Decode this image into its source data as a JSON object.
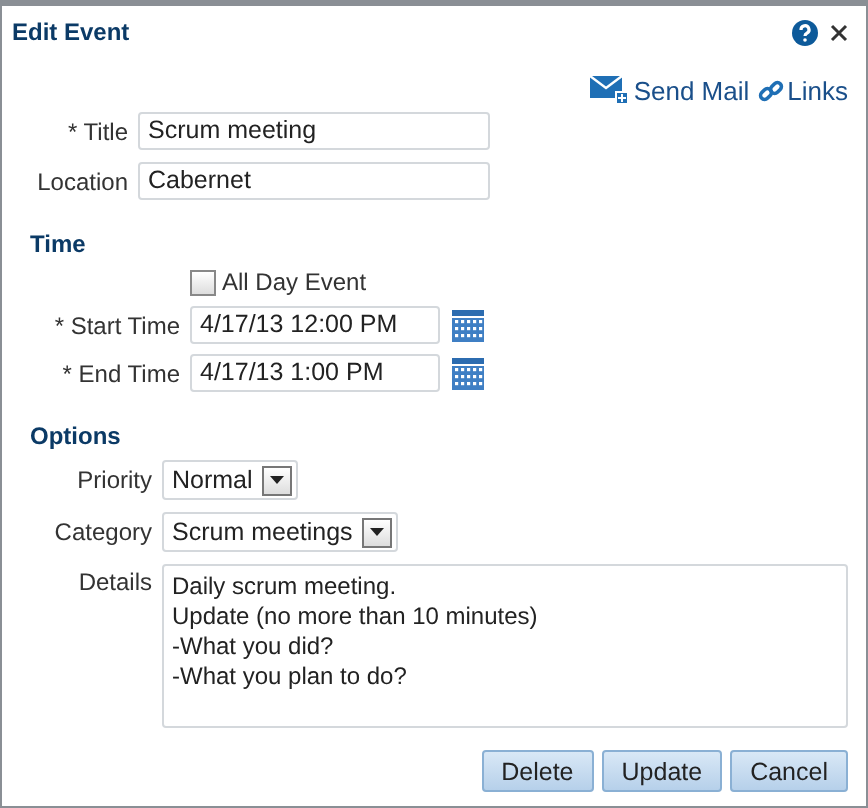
{
  "window": {
    "title": "Edit Event"
  },
  "actions": [
    {
      "kind": "mail",
      "label": "Send Mail"
    },
    {
      "kind": "link",
      "label": "Links"
    }
  ],
  "general": [
    {
      "label": "* Title",
      "value": "Scrum meeting"
    },
    {
      "label": "Location",
      "value": "Cabernet"
    }
  ],
  "time": {
    "heading": "Time",
    "all_day": {
      "label": "All Day Event",
      "checked": false
    },
    "fields": [
      {
        "label": "* Start Time",
        "value": "4/17/13 12:00 PM"
      },
      {
        "label": "* End Time",
        "value": "4/17/13 1:00 PM"
      }
    ]
  },
  "options": {
    "heading": "Options",
    "selects": [
      {
        "label": "Priority",
        "value": "Normal"
      },
      {
        "label": "Category",
        "value": "Scrum meetings"
      }
    ],
    "details": {
      "label": "Details",
      "value": "Daily scrum meeting.\nUpdate (no more than 10 minutes)\n-What you did?\n-What you plan to do?"
    }
  },
  "buttons": [
    "Delete",
    "Update",
    "Cancel"
  ]
}
